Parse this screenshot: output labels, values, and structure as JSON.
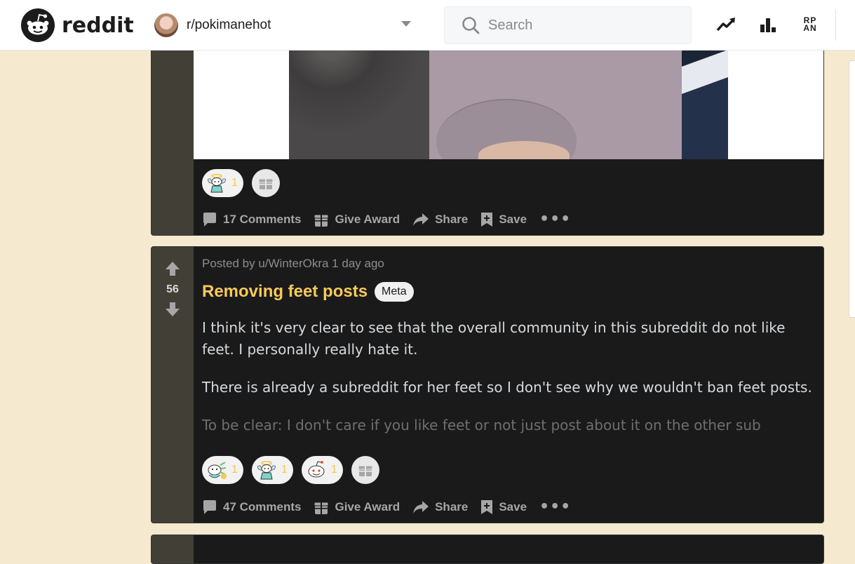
{
  "header": {
    "logo_text": "reddit",
    "subreddit": "r/pokimanehot",
    "search_placeholder": "Search",
    "icons": [
      "trending-icon",
      "leaderboard-icon",
      "rpan-icon"
    ],
    "rpan_label": "RPAN"
  },
  "posts": [
    {
      "awards": [
        {
          "icon": "angel-award-icon",
          "count": "1"
        }
      ],
      "give_award_icon": "gift-icon",
      "actions": {
        "comments": "17 Comments",
        "give_award": "Give Award",
        "share": "Share",
        "save": "Save",
        "more": "•••"
      }
    },
    {
      "score": "56",
      "meta": "Posted by u/WinterOkra 1 day ago",
      "title": "Removing feet posts",
      "flair": "Meta",
      "body": [
        "I think it's very clear to see that the overall community in this subreddit do not like feet. I personally really hate it.",
        "There is already a subreddit for her feet so I don't see why we wouldn't ban feet posts.",
        "To be clear: I don't care if you like feet or not just post about it on the other sub"
      ],
      "awards": [
        {
          "icon": "wholesome-award-icon",
          "count": "1"
        },
        {
          "icon": "angel-award-icon",
          "count": "1"
        },
        {
          "icon": "snoo-award-icon",
          "count": "1"
        }
      ],
      "give_award_icon": "gift-icon",
      "actions": {
        "comments": "47 Comments",
        "give_award": "Give Award",
        "share": "Share",
        "save": "Save",
        "more": "•••"
      }
    }
  ],
  "colors": {
    "page_bg": "#f5eacf",
    "post_bg": "#1a1a1b",
    "vote_col": "#424036",
    "title": "#f7c95a",
    "award_count": "#f2c94c"
  }
}
